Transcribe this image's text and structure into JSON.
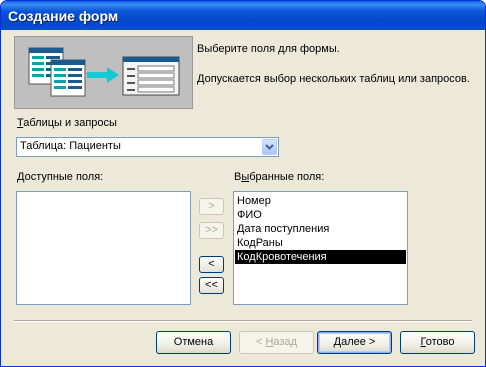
{
  "window": {
    "title": "Создание форм"
  },
  "header": {
    "hint1": "Выберите поля для формы.",
    "hint2": "Допускается выбор нескольких таблиц или запросов."
  },
  "tables": {
    "label_underlined": "Т",
    "label_rest": "аблицы и запросы",
    "selected": "Таблица: Пациенты"
  },
  "available": {
    "label_underlined": "Д",
    "label_rest": "оступные поля:",
    "items": []
  },
  "selected": {
    "label_pre": "В",
    "label_underlined": "ы",
    "label_rest": "бранные поля:",
    "items": [
      "Номер",
      "ФИО",
      "Дата поступления",
      "КодРаны",
      "КодКровотечения"
    ]
  },
  "move": {
    "add": ">",
    "add_all": ">>",
    "remove": "<",
    "remove_all": "<<"
  },
  "buttons": {
    "cancel": "Отмена",
    "back_prefix": "< ",
    "back_underlined": "Н",
    "back_rest": "азад",
    "next_underlined": "Д",
    "next_rest": "алее >",
    "finish_underlined": "Г",
    "finish_rest": "отово"
  }
}
